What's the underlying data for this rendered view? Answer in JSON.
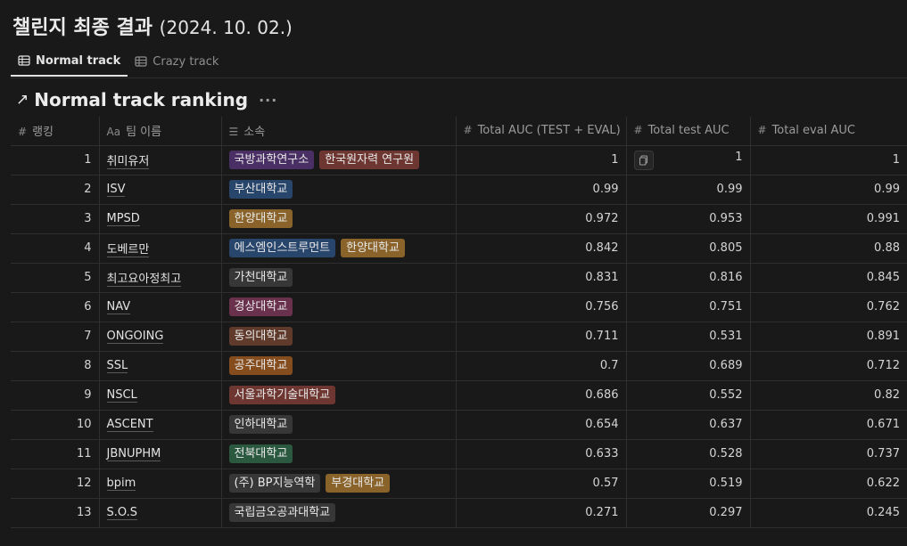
{
  "page": {
    "title": "챌린지 최종 결과",
    "date": "(2024. 10. 02.)"
  },
  "tabs": [
    {
      "label": "Normal track",
      "icon": "table-icon",
      "active": true
    },
    {
      "label": "Crazy track",
      "icon": "table-icon",
      "active": false
    }
  ],
  "view": {
    "title": "Normal track ranking",
    "more": "···"
  },
  "columns": {
    "rank": "랭킹",
    "team": "팀 이름",
    "affiliation": "소속",
    "total": "Total AUC (TEST + EVAL)",
    "test": "Total test AUC",
    "eval": "Total eval AUC"
  },
  "column_icons": {
    "rank": "#",
    "team": "Aa",
    "affiliation": "☰",
    "total": "#",
    "test": "#",
    "eval": "#"
  },
  "tag_colors": {
    "purple": "#492f64",
    "red": "#6e3630",
    "blue": "#28456c",
    "yellow": "#89632a",
    "brown": "#603b2c",
    "gray": "#373737",
    "pink": "#69314c",
    "orange": "#854c1d",
    "green": "#2b593f",
    "default": "#373737"
  },
  "rows": [
    {
      "rank": "1",
      "team": "취미유저",
      "tags": [
        {
          "label": "국방과학연구소",
          "color": "purple"
        },
        {
          "label": "한국원자력 연구원",
          "color": "red"
        }
      ],
      "total": "1",
      "test": "1",
      "eval": "1"
    },
    {
      "rank": "2",
      "team": "ISV",
      "tags": [
        {
          "label": "부산대학교",
          "color": "blue"
        }
      ],
      "total": "0.99",
      "test": "0.99",
      "eval": "0.99"
    },
    {
      "rank": "3",
      "team": "MPSD",
      "tags": [
        {
          "label": "한양대학교",
          "color": "yellow"
        }
      ],
      "total": "0.972",
      "test": "0.953",
      "eval": "0.991"
    },
    {
      "rank": "4",
      "team": "도베르만",
      "tags": [
        {
          "label": "에스엠인스트루먼트",
          "color": "blue"
        },
        {
          "label": "한양대학교",
          "color": "yellow"
        }
      ],
      "total": "0.842",
      "test": "0.805",
      "eval": "0.88"
    },
    {
      "rank": "5",
      "team": "최고요아정최고",
      "tags": [
        {
          "label": "가천대학교",
          "color": "gray"
        }
      ],
      "total": "0.831",
      "test": "0.816",
      "eval": "0.845"
    },
    {
      "rank": "6",
      "team": "NAV",
      "tags": [
        {
          "label": "경상대학교",
          "color": "pink"
        }
      ],
      "total": "0.756",
      "test": "0.751",
      "eval": "0.762"
    },
    {
      "rank": "7",
      "team": "ONGOING",
      "tags": [
        {
          "label": "동의대학교",
          "color": "brown"
        }
      ],
      "total": "0.711",
      "test": "0.531",
      "eval": "0.891"
    },
    {
      "rank": "8",
      "team": "SSL",
      "tags": [
        {
          "label": "공주대학교",
          "color": "orange"
        }
      ],
      "total": "0.7",
      "test": "0.689",
      "eval": "0.712"
    },
    {
      "rank": "9",
      "team": "NSCL",
      "tags": [
        {
          "label": "서울과학기술대학교",
          "color": "red"
        }
      ],
      "total": "0.686",
      "test": "0.552",
      "eval": "0.82"
    },
    {
      "rank": "10",
      "team": "ASCENT",
      "tags": [
        {
          "label": "인하대학교",
          "color": "gray"
        }
      ],
      "total": "0.654",
      "test": "0.637",
      "eval": "0.671"
    },
    {
      "rank": "11",
      "team": "JBNUPHM",
      "tags": [
        {
          "label": "전북대학교",
          "color": "green"
        }
      ],
      "total": "0.633",
      "test": "0.528",
      "eval": "0.737"
    },
    {
      "rank": "12",
      "team": "bpim",
      "tags": [
        {
          "label": "(주) BP지능역학",
          "color": "default"
        },
        {
          "label": "부경대학교",
          "color": "yellow"
        }
      ],
      "total": "0.57",
      "test": "0.519",
      "eval": "0.622"
    },
    {
      "rank": "13",
      "team": "S.O.S",
      "tags": [
        {
          "label": "국립금오공과대학교",
          "color": "gray"
        }
      ],
      "total": "0.271",
      "test": "0.297",
      "eval": "0.245"
    }
  ]
}
